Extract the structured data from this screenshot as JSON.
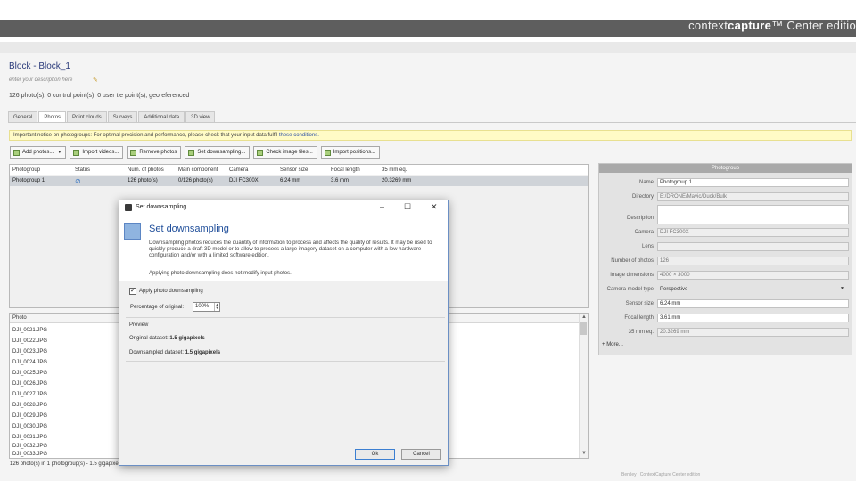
{
  "branding": {
    "product_prefix": "context",
    "product_accent": "capture",
    "product_suffix": "™  Center editio"
  },
  "block": {
    "title": "Block - Block_1",
    "description_placeholder": "enter your description here",
    "summary": "126 photo(s), 0 control point(s), 0 user tie point(s), georeferenced"
  },
  "tabs": [
    "General",
    "Photos",
    "Point clouds",
    "Surveys",
    "Additional data",
    "3D view"
  ],
  "active_tab": "Photos",
  "notice": {
    "text": "Important notice on photogroups: For optimal precision and performance, please check that your input data fulfil",
    "link": "these conditions."
  },
  "toolbar": {
    "add_photos": "Add photos...",
    "import_videos": "Import videos...",
    "remove_photos": "Remove photos",
    "set_downsampling": "Set downsampling...",
    "check_image_files": "Check image files...",
    "import_positions": "Import positions..."
  },
  "photogroups": {
    "columns": [
      "Photogroup",
      "Status",
      "Num. of photos",
      "Main component",
      "Camera",
      "Sensor size",
      "Focal length",
      "35 mm eq."
    ],
    "rows": [
      [
        "Photogroup 1",
        "",
        "126 photo(s)",
        "0/126 photo(s)",
        "DJI FC300X",
        "6.24 mm",
        "3.6 mm",
        "20.3269 mm"
      ]
    ]
  },
  "photo_list": {
    "header": "Photo",
    "items": [
      "DJI_0021.JPG",
      "DJI_0022.JPG",
      "DJI_0023.JPG",
      "DJI_0024.JPG",
      "DJI_0025.JPG",
      "DJI_0026.JPG",
      "DJI_0027.JPG",
      "DJI_0028.JPG",
      "DJI_0029.JPG",
      "DJI_0030.JPG",
      "DJI_0031.JPG",
      "DJI_0032.JPG",
      "DJI_0033.JPG"
    ],
    "footer": "126 photo(s) in 1 photogroup(s) - 1.5 gigapixels"
  },
  "properties": {
    "title": "Photogroup",
    "fields": [
      {
        "label": "Name",
        "value": "Photogroup 1",
        "style": "white"
      },
      {
        "label": "Directory",
        "value": "E:/DRONE/Mavic/Duck/Bulk",
        "style": "grey"
      },
      {
        "label": "Description",
        "value": "",
        "style": "white-tall"
      },
      {
        "label": "Camera",
        "value": "DJI FC300X",
        "style": "grey"
      },
      {
        "label": "Lens",
        "value": "",
        "style": "grey"
      },
      {
        "label": "Number of photos",
        "value": "126",
        "style": "grey"
      },
      {
        "label": "Image dimensions",
        "value": "4000 × 3000",
        "style": "grey"
      },
      {
        "label": "Camera model type",
        "value": "Perspective",
        "style": "combo"
      },
      {
        "label": "Sensor size",
        "value": "6.24 mm",
        "style": "white"
      },
      {
        "label": "Focal length",
        "value": "3.61 mm",
        "style": "white"
      },
      {
        "label": "35 mm eq.",
        "value": "20.3269 mm",
        "style": "grey"
      }
    ],
    "more": "More..."
  },
  "watermark": "Bentley | ContextCapture Center edition",
  "dialog": {
    "window_title": "Set downsampling",
    "heading": "Set downsampling",
    "body": "Downsampling photos reduces the quantity of information to process and affects the quality of results. It may be used to quickly produce a draft 3D model or to allow to process a large imagery dataset on a computer with a low hardware configuration and/or with a limited software edition.",
    "note": "Applying photo downsampling does not modify input photos.",
    "apply_label": "Apply photo downsampling",
    "apply_checked": true,
    "percentage_label": "Percentage of original:",
    "percentage_value": "100%",
    "preview_label": "Preview",
    "original_label": "Original dataset:",
    "original_value": "1.5 gigapixels",
    "downsampled_label": "Downsampled dataset:",
    "downsampled_value": "1.5 gigapixels",
    "ok": "Ok",
    "cancel": "Cancel"
  }
}
